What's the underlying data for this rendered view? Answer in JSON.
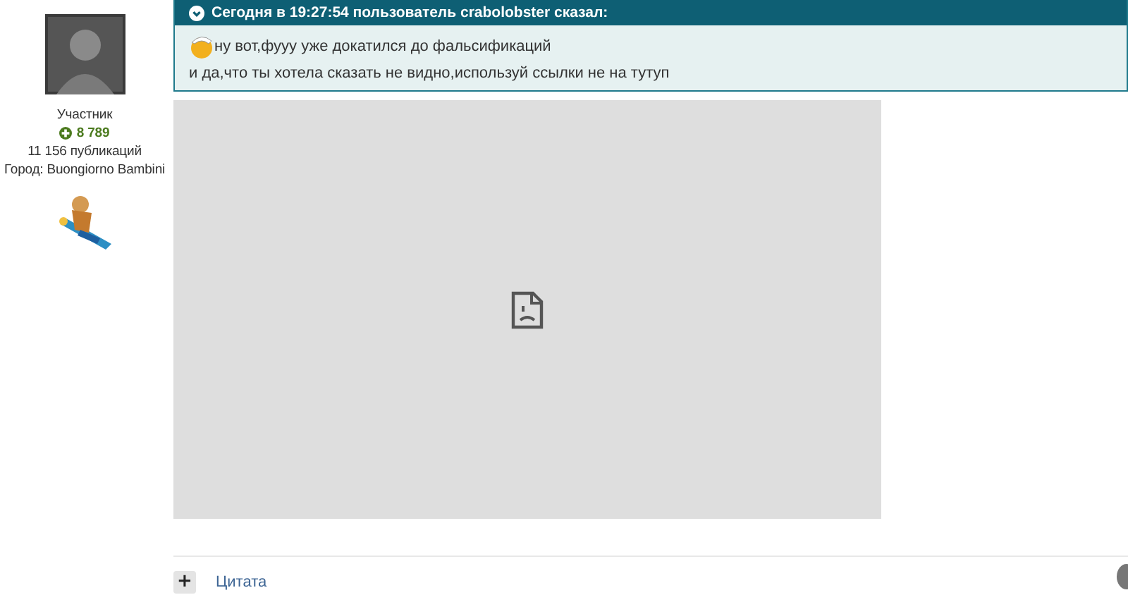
{
  "author": {
    "role": "Участник",
    "reputation": "8 789",
    "posts": "11 156 публикаций",
    "city": "Город: Buongiorno Bambini"
  },
  "quote": {
    "header": "Сегодня в 19:27:54 пользователь crabolobster сказал:",
    "lines": [
      "ну вот,фууу уже докатился до фальсификаций",
      "и да,что ты хотела сказать не видно,используй ссылки не на тутуп"
    ]
  },
  "embed": {
    "kind": "broken"
  },
  "footer": {
    "add_button": "+",
    "quote_link": "Цитата"
  }
}
